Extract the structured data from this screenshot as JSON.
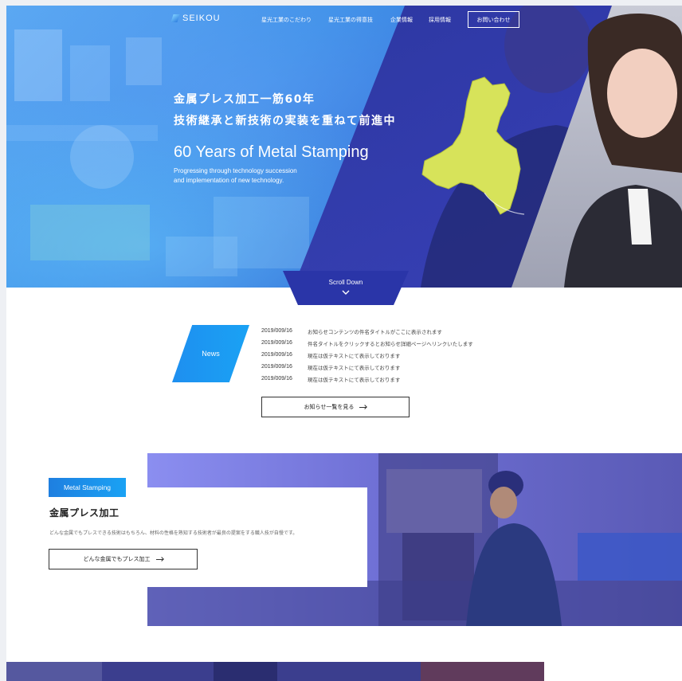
{
  "header": {
    "logo_text": "SEIKOU",
    "nav": [
      {
        "label": "星光工業のこだわり"
      },
      {
        "label": "星光工業の得意技"
      },
      {
        "label": "企業情報"
      },
      {
        "label": "採用情報"
      }
    ],
    "contact_label": "お問い合わせ"
  },
  "hero": {
    "jp_line1": "金属プレス加工一筋60年",
    "jp_line2": "技術継承と新技術の実装を重ねて前進中",
    "en_title": "60 Years of Metal Stamping",
    "en_sub1": "Progressing through technology succession",
    "en_sub2": "and implementation of new technology.",
    "scroll_label": "Scroll Down"
  },
  "news": {
    "badge": "News",
    "items": [
      {
        "date": "2019/009/16",
        "title": "お知らせコンテンツの件名タイトルがここに表示されます"
      },
      {
        "date": "2019/009/16",
        "title": "件名タイトルをクリックするとお知らせ詳細ページへリンクいたします"
      },
      {
        "date": "2019/009/16",
        "title": "現在は仮テキストにて表示しております"
      },
      {
        "date": "2019/009/16",
        "title": "現在は仮テキストにて表示しております"
      },
      {
        "date": "2019/009/16",
        "title": "現在は仮テキストにて表示しております"
      }
    ],
    "more_label": "お知らせ一覧を見る"
  },
  "metal_stamping": {
    "tag": "Metal Stamping",
    "title": "金属プレス加工",
    "description": "どんな金属でもプレスできる技術はもちろん、材料の性格を熟知する技術者が最良の提案をする職人技が自慢です。",
    "button_label": "どんな金属でもプレス加工"
  },
  "colors": {
    "accent_blue": "#1aa2f4",
    "navy": "#2a35a8",
    "map_yellow": "#d7e35a"
  }
}
